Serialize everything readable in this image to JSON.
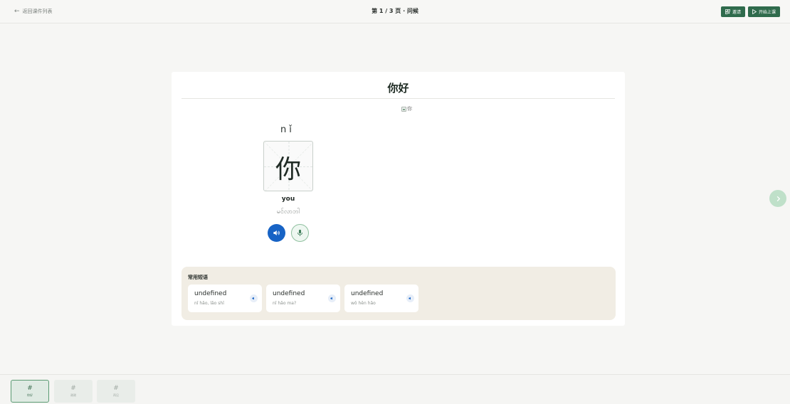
{
  "header": {
    "back_label": "返回课件列表",
    "page_title": "第 1 / 3 页 · 问候",
    "invite_label": "邀请",
    "start_label": "开始上课"
  },
  "slide": {
    "title": "你好",
    "image_alt": "你",
    "word": {
      "pinyin": "nǐ",
      "hanzi": "你",
      "meaning": "you",
      "translation": "မင်လာဘါ"
    },
    "phrases_title": "常用短语",
    "phrases": [
      {
        "text": "undefined",
        "pinyin": "nǐ hǎo, lǎo shī"
      },
      {
        "text": "undefined",
        "pinyin": "nǐ hǎo ma?"
      },
      {
        "text": "undefined",
        "pinyin": "wǒ hěn hǎo"
      }
    ]
  },
  "bottom_tabs": [
    {
      "icon": "#",
      "label": "你好"
    },
    {
      "icon": "#",
      "label": "谢谢"
    },
    {
      "icon": "#",
      "label": "再见"
    }
  ],
  "colors": {
    "primary_green": "#2f6b4c",
    "audio_blue": "#1763c5",
    "panel_beige": "#f1ede4"
  }
}
